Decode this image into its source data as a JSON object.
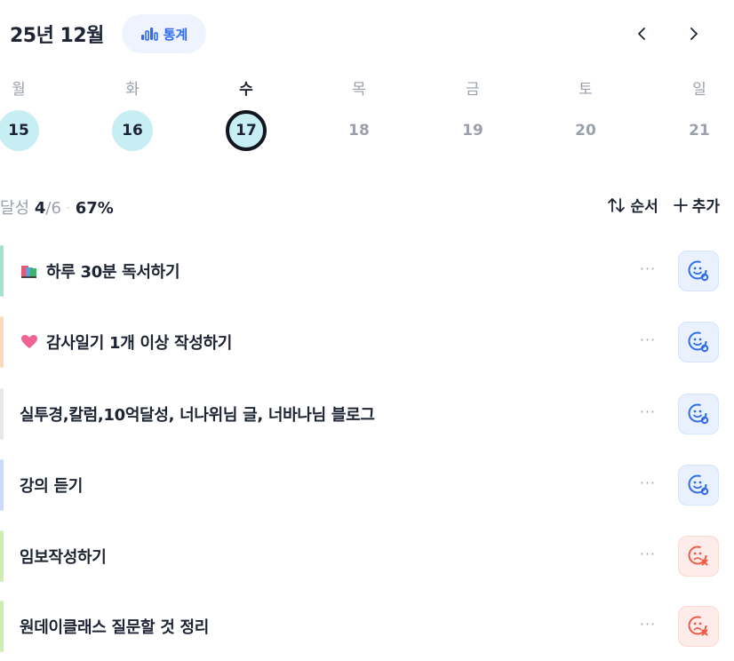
{
  "header": {
    "month_title": "25년 12월",
    "stats_label": "통계",
    "prev_icon": "chevron-left-icon",
    "next_icon": "chevron-right-icon"
  },
  "week": {
    "weekdays": [
      "월",
      "화",
      "수",
      "목",
      "금",
      "토",
      "일"
    ],
    "days": [
      {
        "num": "15",
        "state": "done"
      },
      {
        "num": "16",
        "state": "done"
      },
      {
        "num": "17",
        "state": "today"
      },
      {
        "num": "18",
        "state": "future"
      },
      {
        "num": "19",
        "state": "future"
      },
      {
        "num": "20",
        "state": "future"
      },
      {
        "num": "21",
        "state": "future"
      }
    ]
  },
  "summary": {
    "label": "달성",
    "done": "4",
    "total": "/6",
    "sep": "·",
    "percent": "67%"
  },
  "actions": {
    "order_label": "순서",
    "add_label": "추가"
  },
  "tasks": [
    {
      "title": "하루 30분 독서하기",
      "emoji": "books-icon",
      "bar_color": "#9fe3c8",
      "status": "ok"
    },
    {
      "title": "감사일기 1개 이상 작성하기",
      "emoji": "pink-heart-icon",
      "bar_color": "#fcd9b8",
      "status": "ok"
    },
    {
      "title": "실투경,칼럼,10억달성, 너나위님 글, 너바나님 블로그",
      "emoji": "",
      "bar_color": "#e6e8ec",
      "status": "ok"
    },
    {
      "title": "강의 듣기",
      "emoji": "",
      "bar_color": "#c9dafc",
      "status": "ok"
    },
    {
      "title": "임보작성하기",
      "emoji": "",
      "bar_color": "#cdeeb0",
      "status": "fail"
    },
    {
      "title": "원데이클래스 질문할 것 정리",
      "emoji": "",
      "bar_color": "#cdeeb0",
      "status": "fail"
    }
  ],
  "more_label": "···",
  "colors": {
    "accent": "#2f6bf1",
    "done_day": "#c6eef3",
    "fail": "#ef5a46"
  }
}
